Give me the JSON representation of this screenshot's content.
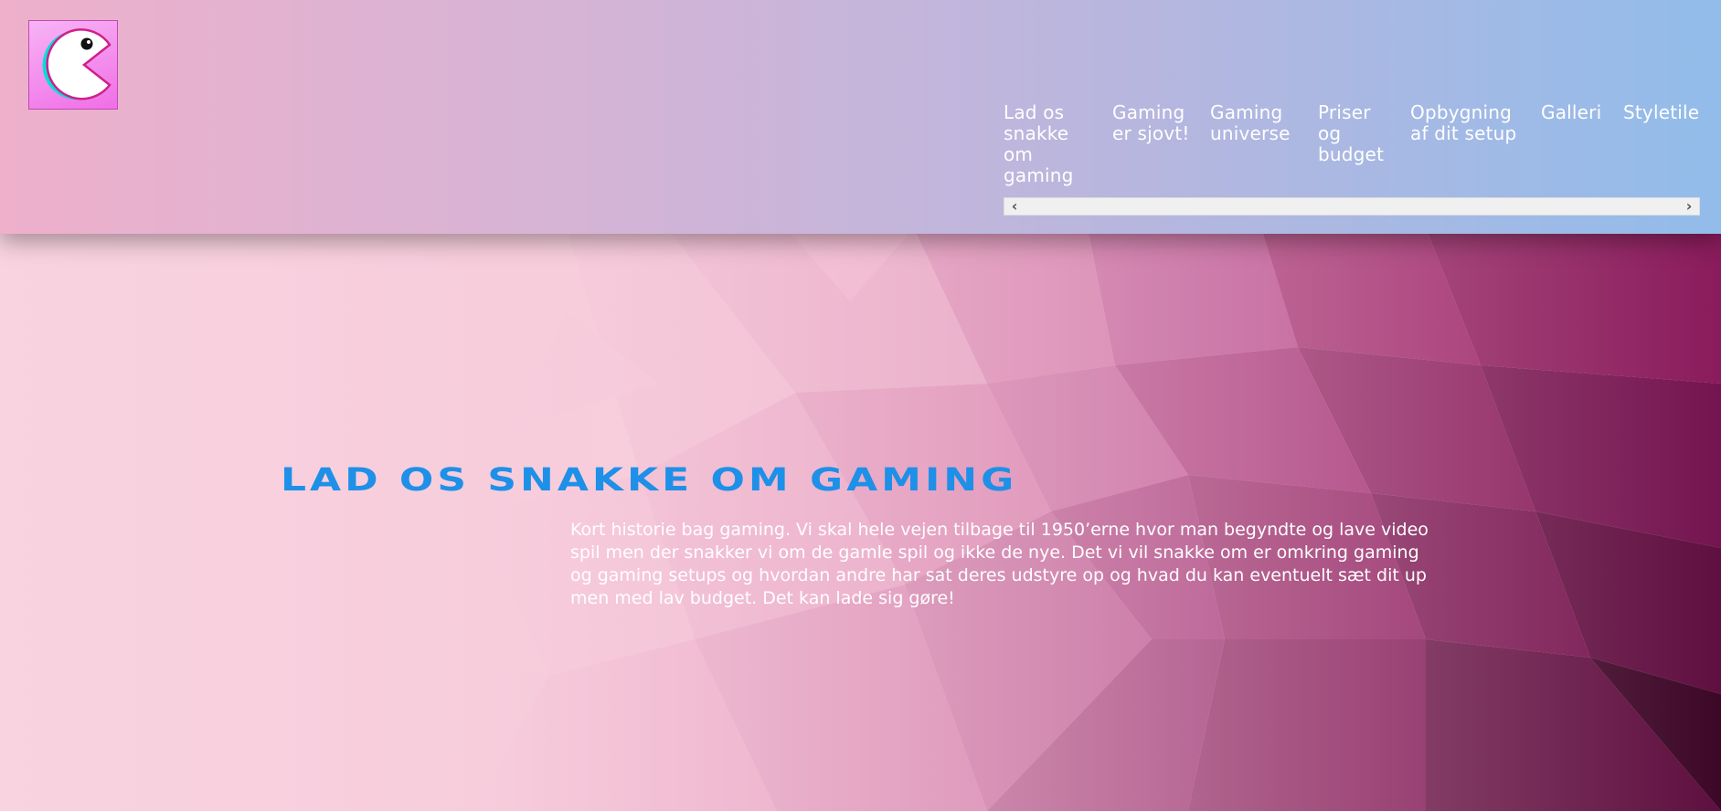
{
  "header": {
    "nav": [
      {
        "label": "Lad os snakke om gaming"
      },
      {
        "label": "Gaming er sjovt!"
      },
      {
        "label": "Gaming universe"
      },
      {
        "label": "Priser og budget"
      },
      {
        "label": "Opbygning af dit setup"
      },
      {
        "label": "Galleri"
      },
      {
        "label": "Styletile"
      }
    ],
    "scroll_left": "‹",
    "scroll_right": "›"
  },
  "hero": {
    "title": "LAD OS SNAKKE OM GAMING",
    "text": "Kort historie bag gaming. Vi skal hele vejen tilbage til 1950’erne hvor man begyndte og lave video spil men der snakker vi om de gamle spil og ikke de nye. Det vi vil snakke om er omkring gaming og gaming setups og hvordan andre har sat deres udstyre op og hvad du kan eventuelt sæt dit up men med lav budget. Det kan lade sig gøre!"
  },
  "icons": {
    "logo": "pacman-logo-icon"
  },
  "colors": {
    "title": "#1e90e8",
    "header_start": "#eeb0cb",
    "header_end": "#92bcea",
    "text": "#ffffff"
  }
}
